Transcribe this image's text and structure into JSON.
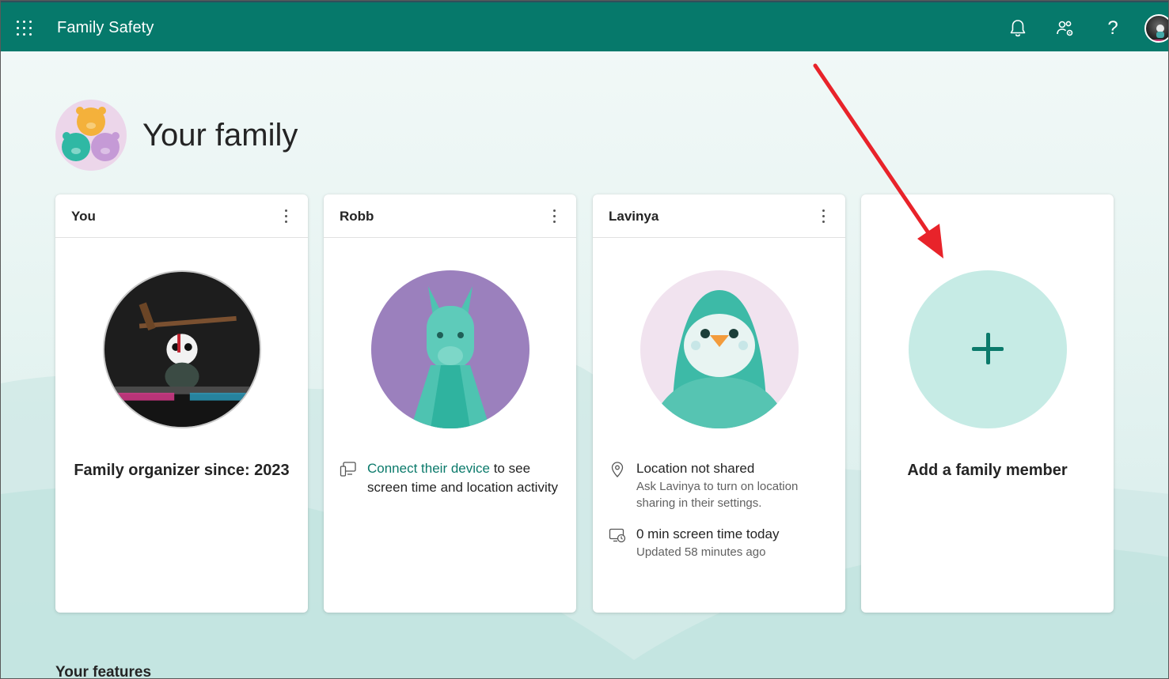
{
  "app": {
    "title": "Family Safety"
  },
  "topbar": {
    "icons": [
      "waffle-icon",
      "bell-icon",
      "family-settings-icon",
      "help-icon",
      "profile-avatar"
    ],
    "help_glyph": "?"
  },
  "page": {
    "title": "Your family"
  },
  "cards": {
    "you": {
      "name": "You",
      "organizer": "Family organizer since: 2023"
    },
    "robb": {
      "name": "Robb",
      "link": "Connect their device",
      "text_rest": " to see screen time and location activity"
    },
    "lavinya": {
      "name": "Lavinya",
      "location_title": "Location not shared",
      "location_sub": "Ask Lavinya to turn on location sharing in their settings.",
      "screen_title": "0 min screen time today",
      "screen_sub": "Updated 58 minutes ago"
    },
    "add": {
      "label": "Add a family member"
    }
  },
  "features": {
    "title": "Your features"
  },
  "colors": {
    "brand": "#06796b",
    "accent": "#0b7a6b",
    "add_circle": "#c6ebe5",
    "annotation_arrow": "#e8232a"
  }
}
